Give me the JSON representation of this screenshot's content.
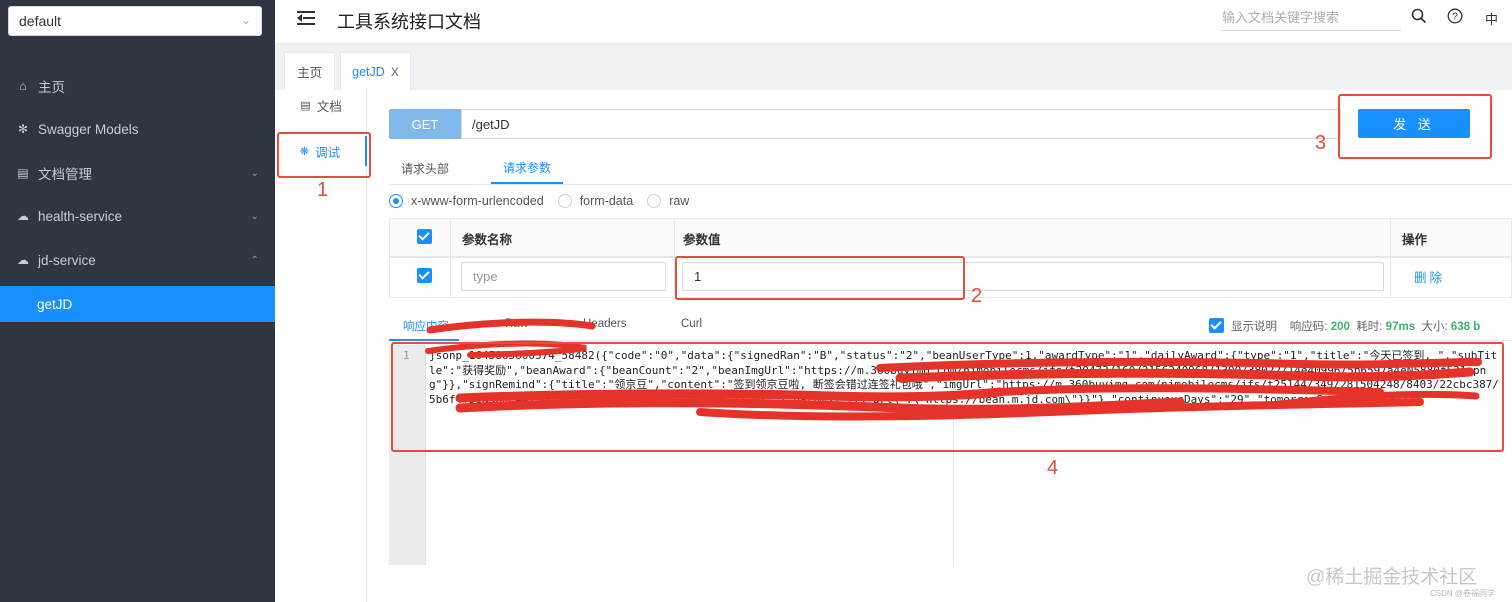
{
  "sidebar": {
    "group_select": "default",
    "items": [
      {
        "label": "主页",
        "icon": "home-icon"
      },
      {
        "label": "Swagger Models",
        "icon": "cube-icon"
      },
      {
        "label": "文档管理",
        "icon": "document-icon"
      },
      {
        "label": "health-service",
        "icon": "cloud-icon"
      },
      {
        "label": "jd-service",
        "icon": "cloud-icon"
      }
    ],
    "sub_items": [
      {
        "label": "getJD"
      }
    ]
  },
  "header": {
    "title": "工具系统接口文档",
    "search_placeholder": "输入文档关键字搜索",
    "lang": "中"
  },
  "tabs": [
    {
      "label": "主页"
    },
    {
      "label": "getJD",
      "close": "X"
    }
  ],
  "doc_nav": {
    "doc": "文档",
    "debug": "调试"
  },
  "request": {
    "method": "GET",
    "url": "/getJD",
    "send_label": "发 送",
    "tabs": [
      "请求头部",
      "请求参数"
    ],
    "content_types": [
      "x-www-form-urlencoded",
      "form-data",
      "raw"
    ]
  },
  "params_table": {
    "headers": {
      "name": "参数名称",
      "value": "参数值",
      "action": "操作"
    },
    "rows": [
      {
        "name_placeholder": "type",
        "value": "1",
        "action": "删除"
      }
    ]
  },
  "response": {
    "tabs": [
      "响应内容",
      "Raw",
      "Headers",
      "Curl"
    ],
    "show_desc": "显示说明",
    "status_label": "响应码:",
    "status": "200",
    "time_label": "耗时:",
    "time": "97ms",
    "size_label": "大小:",
    "size": "638 b",
    "line_number": "1",
    "body": "jsonp_1645865600374_58482({\"code\":\"0\",\"data\":{\"signedRan\":\"B\",\"status\":\"2\",\"beanUserType\":1,\"awardType\":\"1\",\"dailyAward\":{\"type\":\"1\",\"title\":\"今天已签到, \",\"subTitle\":\"获得奖励\",\"beanAward\":{\"beanCount\":\"2\",\"beanImgUrl\":\"https://m.360buyimg.com/njmobilecms/jfs/t20473/160/2156240968/1300/38022/14e40996/5b6597a4eN5880f531.png\"}},\"signRemind\":{\"title\":\"领京豆\",\"content\":\"签到领京豆啦, 断签会错过连签礼包哦\",\"imgUrl\":\"https://m.360buyimg.com/njmobilecms/jfs/t25144/349/281504248/8403/22cbc387/5b6f4f51N3bde447.png\",\"beanHomeLink\":\"{\\\"des\\\":\\\"m\\\",\\\"params\\\":{\\\"url\\\":\\\"https://bean.m.jd.com\\\"}}\"},\"continuousDays\":\"29\",\"tomorrowSendBeans\":0}});"
  },
  "annotations": [
    "1",
    "2",
    "3",
    "4"
  ],
  "watermark": {
    "text": "@稀土掘金技术社区",
    "csdn": "CSDN @卷福同学"
  },
  "colors": {
    "sidebar_bg": "#2f3541",
    "accent": "#1890ff",
    "annotation": "#e74c3c",
    "method_bg": "#80b8ec"
  }
}
